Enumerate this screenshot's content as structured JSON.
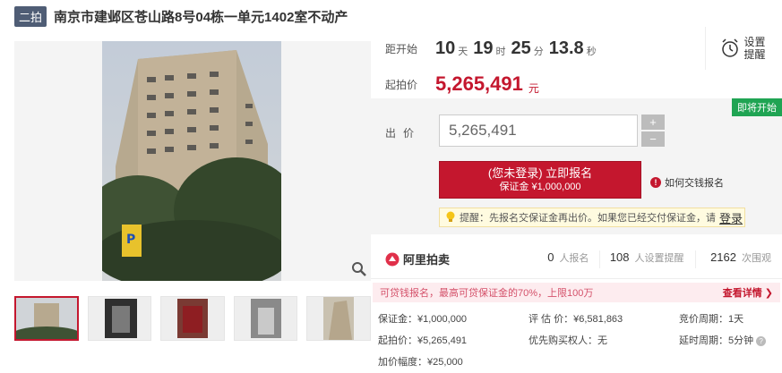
{
  "title": {
    "round_badge": "二拍",
    "text": "南京市建邺区苍山路8号04栋一单元1402室不动产"
  },
  "countdown": {
    "label": "距开始",
    "days": "10",
    "days_unit": "天",
    "hours": "19",
    "hours_unit": "时",
    "minutes": "25",
    "minutes_unit": "分",
    "seconds": "13.8",
    "seconds_unit": "秒"
  },
  "remind": {
    "label": "设置提醒",
    "icon": "alarm-clock-icon"
  },
  "start_price": {
    "label": "起拍价",
    "value": "5,265,491",
    "unit": "元"
  },
  "bid": {
    "status_badge": "即将开始",
    "label": "出价",
    "input_value": "5,265,491",
    "plus": "+",
    "minus": "−",
    "signup_main": "(您未登录) 立即报名",
    "signup_sub": "保证金 ¥1,000,000",
    "howto": "如何交钱报名",
    "tip_text": "提醒：先报名交保证金再出价。如果您已经交付保证金，请",
    "tip_link": "登录"
  },
  "stats": {
    "brand": "阿里拍卖",
    "signups": "0",
    "signups_label": "人报名",
    "reminders": "108",
    "reminders_label": "人设置提醒",
    "views": "2162",
    "views_label": "次围观"
  },
  "promo": {
    "text": "可贷钱报名，最高可贷保证金的70%，上限100万",
    "link": "查看详情 ❯"
  },
  "info": {
    "deposit": "保证金：¥1,000,000",
    "appraisal": "评 估 价：¥6,581,863",
    "bid_cycle": "竞价周期：1天",
    "start_price": "起拍价：¥5,265,491",
    "priority": "优先购买权人：无",
    "delay_cycle": "延时周期：5分钟",
    "increment": "加价幅度：¥25,000"
  },
  "colors": {
    "accent": "#c4172e",
    "badge_green": "#1fa453",
    "round_badge": "#4f5d75"
  }
}
